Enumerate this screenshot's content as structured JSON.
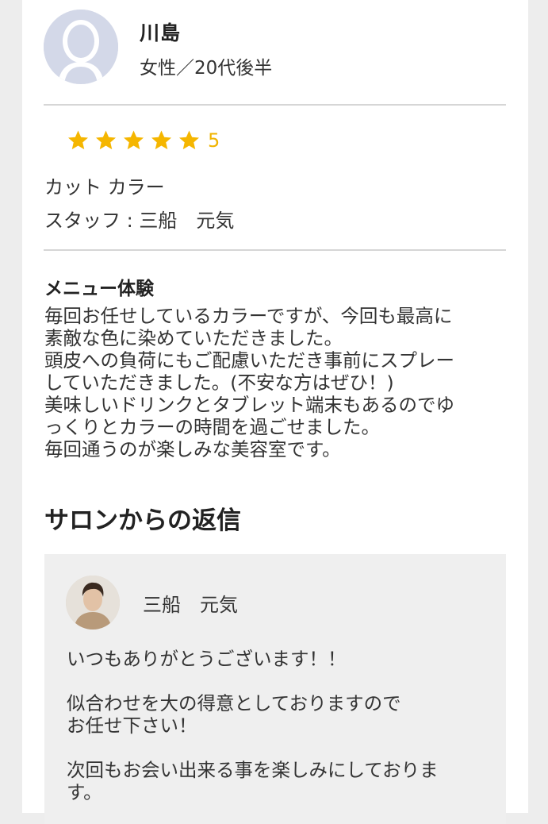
{
  "reviewer": {
    "name": "川島",
    "meta": "女性／20代後半"
  },
  "rating": {
    "stars": 5,
    "label": "5",
    "star_color": "#f5b600"
  },
  "review": {
    "menu": "カット カラー",
    "staff": "スタッフ : 三船　元気",
    "section_title": "メニュー体験",
    "body": "毎回お任せしているカラーですが、今回も最高に\n素敵な色に染めていただきました。\n頭皮への負荷にもご配慮いただき事前にスプレー\nしていただきました。(不安な方はぜひ！)\n美味しいドリンクとタブレット端末もあるのでゆ\nっくりとカラーの時間を過ごせました。\n毎回通うのが楽しみな美容室です。"
  },
  "reply": {
    "heading": "サロンからの返信",
    "staff_name": "三船　元気",
    "body": "いつもありがとうございます！！\n\n似合わせを大の得意としておりますので\nお任せ下さい！\n\n次回もお会い出来る事を楽しみにしておりま\nす。"
  },
  "icons": {
    "reviewer_avatar": "default-user-silhouette-icon",
    "star": "star-icon"
  }
}
